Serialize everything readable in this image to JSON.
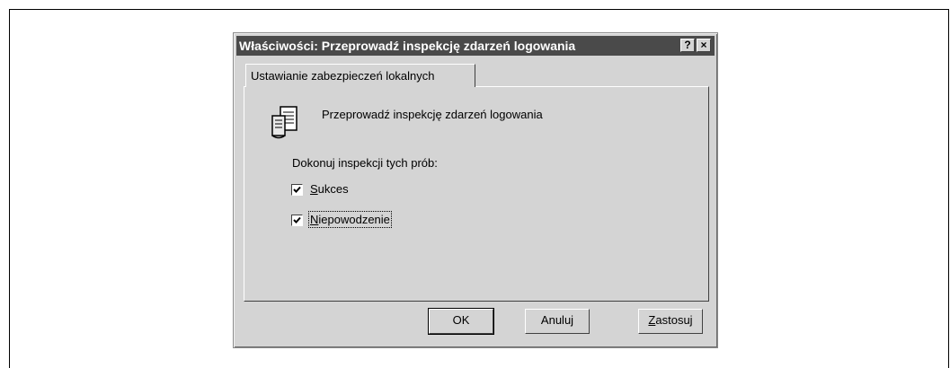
{
  "window": {
    "title": "Właściwości: Przeprowadź inspekcję zdarzeń logowania",
    "help_label": "?",
    "close_label": "×"
  },
  "tab": {
    "label": "Ustawianie zabezpieczeń lokalnych"
  },
  "policy": {
    "title": "Przeprowadź inspekcję zdarzeń logowania",
    "icon": "policy-document-icon"
  },
  "audit": {
    "label": "Dokonuj inspekcji tych prób:",
    "checkboxes": [
      {
        "accel": "S",
        "rest": "ukces",
        "checked": true
      },
      {
        "accel": "N",
        "rest": "iepowodzenie",
        "checked": true
      }
    ]
  },
  "buttons": {
    "ok": "OK",
    "cancel": "Anuluj",
    "apply_accel": "Z",
    "apply_rest": "astosuj"
  }
}
